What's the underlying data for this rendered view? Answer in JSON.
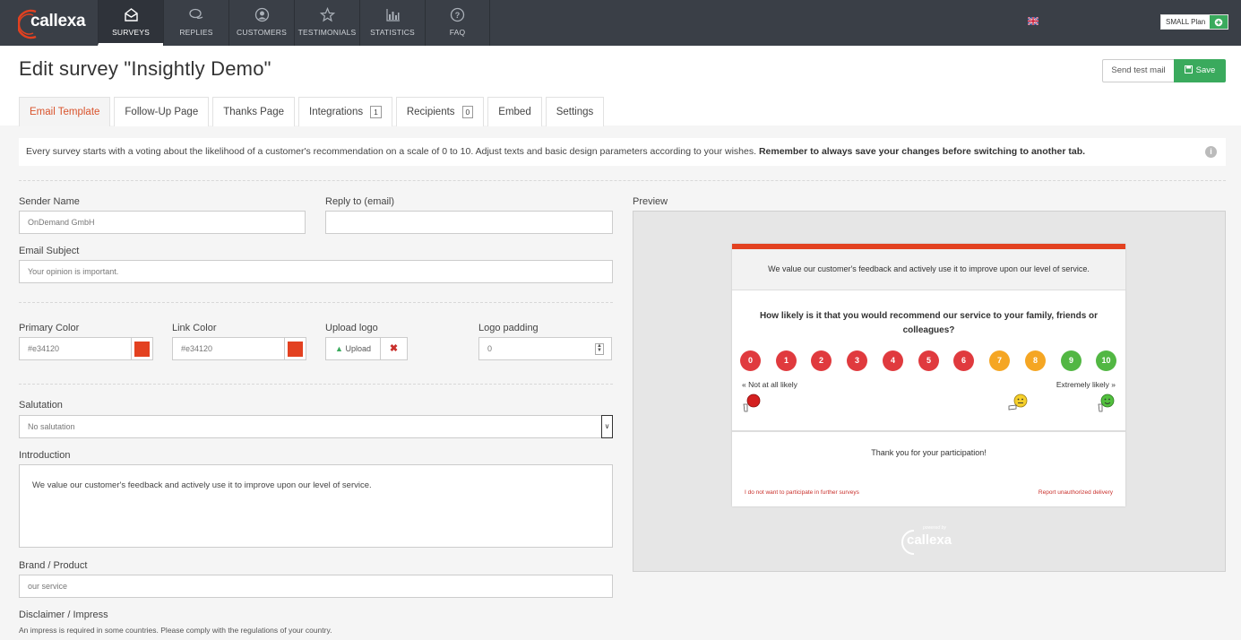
{
  "app": {
    "logo_text": "callexa"
  },
  "nav": {
    "items": [
      {
        "label": "SURVEYS",
        "icon": "envelope-open-icon",
        "active": true
      },
      {
        "label": "REPLIES",
        "icon": "chat-bubbles-icon",
        "active": false
      },
      {
        "label": "CUSTOMERS",
        "icon": "user-circle-icon",
        "active": false
      },
      {
        "label": "TESTIMONIALS",
        "icon": "star-icon",
        "active": false
      },
      {
        "label": "STATISTICS",
        "icon": "bar-chart-icon",
        "active": false
      },
      {
        "label": "FAQ",
        "icon": "question-circle-icon",
        "active": false
      }
    ],
    "language_flag": "uk-flag-icon",
    "plan_label": "SMALL Plan",
    "plan_button_icon": "plus-circle-icon"
  },
  "header": {
    "title": "Edit survey \"Insightly Demo\"",
    "send_test_label": "Send test mail",
    "save_label": "Save"
  },
  "tabs": [
    {
      "label": "Email Template",
      "active": true,
      "count": null
    },
    {
      "label": "Follow-Up Page",
      "active": false,
      "count": null
    },
    {
      "label": "Thanks Page",
      "active": false,
      "count": null
    },
    {
      "label": "Integrations",
      "active": false,
      "count": "1"
    },
    {
      "label": "Recipients",
      "active": false,
      "count": "0"
    },
    {
      "label": "Embed",
      "active": false,
      "count": null
    },
    {
      "label": "Settings",
      "active": false,
      "count": null
    }
  ],
  "info": {
    "text": "Every survey starts with a voting about the likelihood of a customer's recommendation on a scale of 0 to 10. Adjust texts and basic design parameters according to your wishes. ",
    "bold": "Remember to always save your changes before switching to another tab."
  },
  "form": {
    "sender_name_label": "Sender Name",
    "sender_name_value": "OnDemand GmbH",
    "reply_to_label": "Reply to (email)",
    "reply_to_value": "",
    "subject_label": "Email Subject",
    "subject_placeholder": "Your opinion is important.",
    "primary_color_label": "Primary Color",
    "primary_color_value": "#e34120",
    "link_color_label": "Link Color",
    "link_color_value": "#e34120",
    "upload_logo_label": "Upload logo",
    "upload_button_label": "Upload",
    "logo_padding_label": "Logo padding",
    "logo_padding_value": "0",
    "salutation_label": "Salutation",
    "salutation_value": "No salutation",
    "introduction_label": "Introduction",
    "introduction_value": "We value our customer's feedback and actively use it to improve upon our level of service.",
    "brand_label": "Brand / Product",
    "brand_value": "our service",
    "disclaimer_label": "Disclaimer / Impress",
    "disclaimer_hint": "An impress is required in some countries. Please comply with the regulations of your country."
  },
  "preview": {
    "label": "Preview",
    "accent_color": "#e34120",
    "header_text": "We value our customer's feedback and actively use it to improve upon our level of service.",
    "question": "How likely is it that you would recommend our service to your family, friends or colleagues?",
    "scale": [
      {
        "n": "0",
        "color": "#e03a3e"
      },
      {
        "n": "1",
        "color": "#e03a3e"
      },
      {
        "n": "2",
        "color": "#e03a3e"
      },
      {
        "n": "3",
        "color": "#e03a3e"
      },
      {
        "n": "4",
        "color": "#e03a3e"
      },
      {
        "n": "5",
        "color": "#e03a3e"
      },
      {
        "n": "6",
        "color": "#e03a3e"
      },
      {
        "n": "7",
        "color": "#f5a623"
      },
      {
        "n": "8",
        "color": "#f5a623"
      },
      {
        "n": "9",
        "color": "#52b743"
      },
      {
        "n": "10",
        "color": "#52b743"
      }
    ],
    "not_likely": "« Not at all likely",
    "extremely_likely": "Extremely likely »",
    "thanks": "Thank you for your participation!",
    "opt_out": "I do not want to participate in further surveys",
    "report": "Report unauthorized delivery",
    "powered_by": "powered by",
    "powered_logo": "callexa"
  }
}
